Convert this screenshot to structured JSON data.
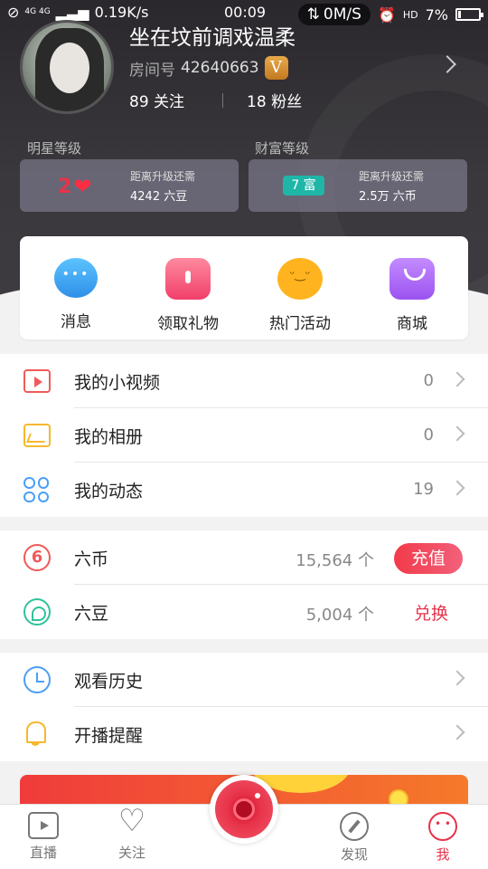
{
  "status_bar": {
    "network": "4G 4G",
    "speed_left": "0.19K/s",
    "time": "00:09",
    "speed_right": "0M/S",
    "battery": "7%",
    "hd": "HD"
  },
  "profile": {
    "name": "坐在坟前调戏温柔",
    "room_label": "房间号",
    "room_number": "42640663",
    "badge": "V",
    "following_count": "89",
    "following_label": "关注",
    "fans_count": "18",
    "fans_label": "粉丝"
  },
  "levels": {
    "star": {
      "label": "明星等级",
      "level": "2",
      "hint": "距离升级还需",
      "value": "4242 六豆"
    },
    "wealth": {
      "label": "财富等级",
      "badge": "7 富",
      "hint": "距离升级还需",
      "value": "2.5万 六币"
    }
  },
  "quick_menu": [
    {
      "label": "消息",
      "icon": "message-icon"
    },
    {
      "label": "领取礼物",
      "icon": "gift-icon"
    },
    {
      "label": "热门活动",
      "icon": "hot-activity-icon"
    },
    {
      "label": "商城",
      "icon": "shop-bag-icon"
    }
  ],
  "media_list": [
    {
      "label": "我的小视频",
      "count": "0"
    },
    {
      "label": "我的相册",
      "count": "0"
    },
    {
      "label": "我的动态",
      "count": "19"
    }
  ],
  "wallet": {
    "coins": {
      "label": "六币",
      "amount": "15,564 个",
      "action": "充值"
    },
    "beans": {
      "label": "六豆",
      "amount": "5,004 个",
      "action": "兑换"
    }
  },
  "misc_list": [
    {
      "label": "观看历史"
    },
    {
      "label": "开播提醒"
    }
  ],
  "tabbar": {
    "live": "直播",
    "follow": "关注",
    "discover": "发现",
    "me": "我"
  },
  "colors": {
    "accent": "#e8334a",
    "header_bg": "#2a282c",
    "wealth_badge": "#1fb6a8"
  }
}
